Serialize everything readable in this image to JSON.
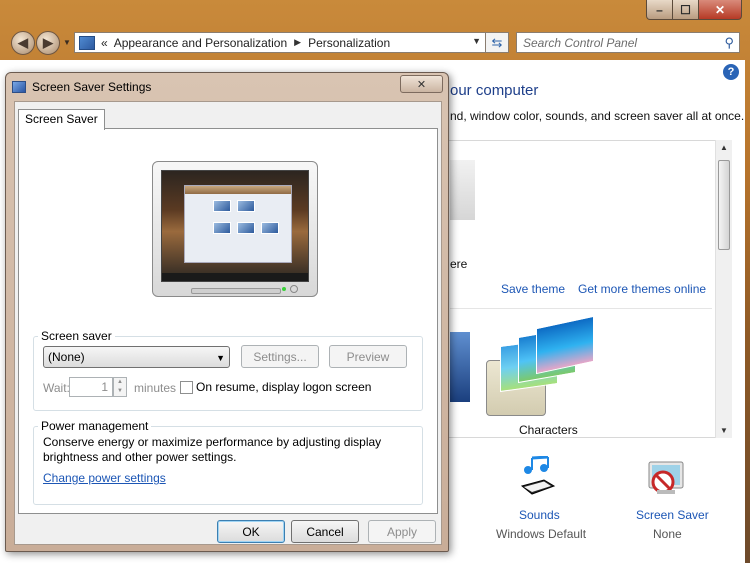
{
  "control_panel": {
    "breadcrumb": [
      "Appearance and Personalization",
      "Personalization"
    ],
    "breadcrumb_prefix": "«",
    "search_placeholder": "Search Control Panel",
    "heading": "our computer",
    "subheading": "nd, window color, sounds, and screen saver all at once.",
    "partial_theme_label": "ere",
    "save_theme": "Save theme",
    "more_themes": "Get more themes online",
    "selected_theme": "Characters",
    "sounds_label": "Sounds",
    "sounds_value": "Windows Default",
    "screensaver_label": "Screen Saver",
    "screensaver_value": "None"
  },
  "dialog": {
    "title": "Screen Saver Settings",
    "close_glyph": "✕",
    "tab": "Screen Saver",
    "screensaver_group": "Screen saver",
    "selected_saver": "(None)",
    "settings_button": "Settings...",
    "preview_button": "Preview",
    "wait_label": "Wait:",
    "wait_value": "1",
    "minutes_label": "minutes",
    "logon_checkbox_label": "On resume, display logon screen",
    "logon_checked": false,
    "power_group": "Power management",
    "power_text": "Conserve energy or maximize performance by adjusting display brightness and other power settings.",
    "power_link": "Change power settings",
    "ok": "OK",
    "cancel": "Cancel",
    "apply": "Apply"
  },
  "colors": {
    "link": "#1c56b5",
    "heading": "#1e3f8a",
    "disabled_text": "#8d8d8d",
    "accent_close": "#b63a25"
  }
}
